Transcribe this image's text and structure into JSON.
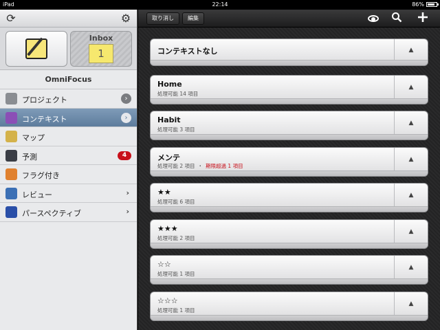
{
  "statusbar": {
    "device": "iPad",
    "time": "22:14",
    "battery": "86%",
    "battery_level": 0.86
  },
  "sidebar": {
    "title": "OmniFocus",
    "inbox_label": "Inbox",
    "inbox_count": "1",
    "items": [
      {
        "label": "プロジェクト",
        "icon": "projects-icon",
        "indicator": "chevron-circle",
        "color": "#8a8d92"
      },
      {
        "label": "コンテキスト",
        "icon": "contexts-icon",
        "indicator": "chevron-circle",
        "color": "#8b4fb6",
        "selected": true
      },
      {
        "label": "マップ",
        "icon": "map-icon",
        "indicator": "none",
        "color": "#d4b24a"
      },
      {
        "label": "予測",
        "icon": "forecast-icon",
        "indicator": "badge",
        "badge": "4",
        "color": "#3a3d45"
      },
      {
        "label": "フラグ付き",
        "icon": "flag-icon",
        "indicator": "none",
        "color": "#e0812f"
      },
      {
        "label": "レビュー",
        "icon": "review-icon",
        "indicator": "chevron",
        "color": "#3c70b5"
      },
      {
        "label": "パースペクティブ",
        "icon": "perspectives-icon",
        "indicator": "chevron",
        "color": "#2a4fa8"
      }
    ]
  },
  "toolbar": {
    "undo_label": "取り消し",
    "edit_label": "編集"
  },
  "contexts": [
    {
      "title": "コンテキストなし",
      "subtitle": ""
    },
    {
      "title": "Home",
      "subtitle": "処理可能 14 項目"
    },
    {
      "title": "Habit",
      "subtitle": "処理可能 3 項目"
    },
    {
      "title": "メンテ",
      "subtitle": "処理可能 2 項目",
      "overdue_sep": "・",
      "overdue": "期限超過 1 項目"
    },
    {
      "title": "★★",
      "subtitle": "処理可能 6 項目"
    },
    {
      "title": "★★★",
      "subtitle": "処理可能 2 項目"
    },
    {
      "title": "☆☆",
      "subtitle": "処理可能 1 項目"
    },
    {
      "title": "☆☆☆",
      "subtitle": "処理可能 1 項目"
    }
  ],
  "icons": {
    "sync": "sync-icon",
    "settings": "gear-icon",
    "eye": "eye-icon",
    "search": "search-icon",
    "add": "plus-icon",
    "collapse": "triangle-up-icon"
  }
}
